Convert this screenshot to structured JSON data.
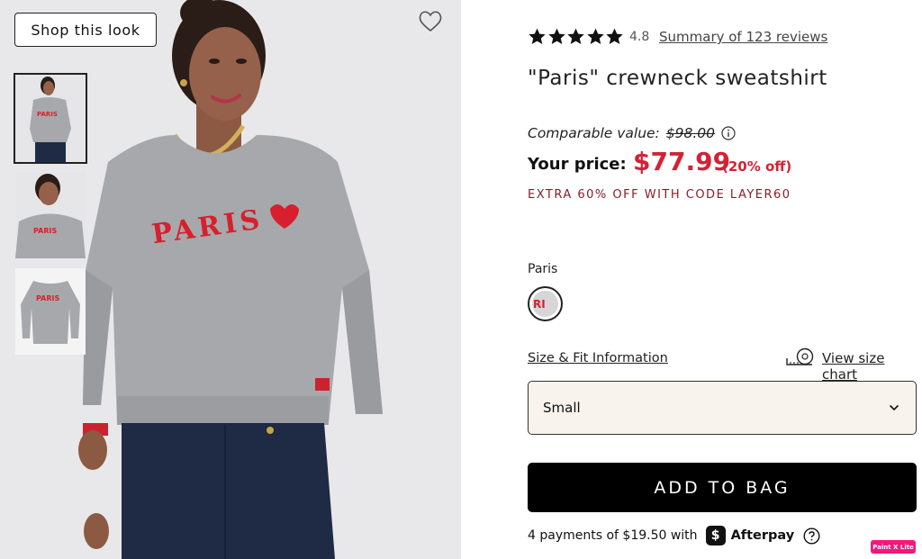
{
  "gallery": {
    "shop_look_label": "Shop this look",
    "hero_text": "PARIS",
    "thumbnails": [
      {
        "name": "thumb-model-full",
        "selected": true
      },
      {
        "name": "thumb-model-closeup",
        "selected": false
      },
      {
        "name": "thumb-flat-lay",
        "selected": false
      }
    ],
    "wishlist_icon": "heart-outline-icon"
  },
  "product": {
    "rating": "4.8",
    "stars": 5,
    "reviews_link": "Summary of 123 reviews",
    "title": "\"Paris\" crewneck sweatshirt",
    "comparable_label": "Comparable value:",
    "comparable_price": "$98.00",
    "your_price_label": "Your price:",
    "sale_price": "$77.99",
    "percent_off": "(20% off)",
    "promo": "EXTRA 60% OFF WITH CODE LAYER60",
    "color_label": "Paris",
    "size_fit_link": "Size & Fit Information",
    "size_chart_link": "View size chart",
    "selected_size": "Small",
    "add_to_bag": "ADD TO BAG",
    "afterpay_text": "4 payments of $19.50 with",
    "afterpay_brand": "Afterpay",
    "extension_badge": "Paint X Lite"
  },
  "colors": {
    "sale_red": "#d22336",
    "promo_red": "#8a1d26",
    "button_black": "#000000",
    "select_bg": "#f8f3ec"
  }
}
